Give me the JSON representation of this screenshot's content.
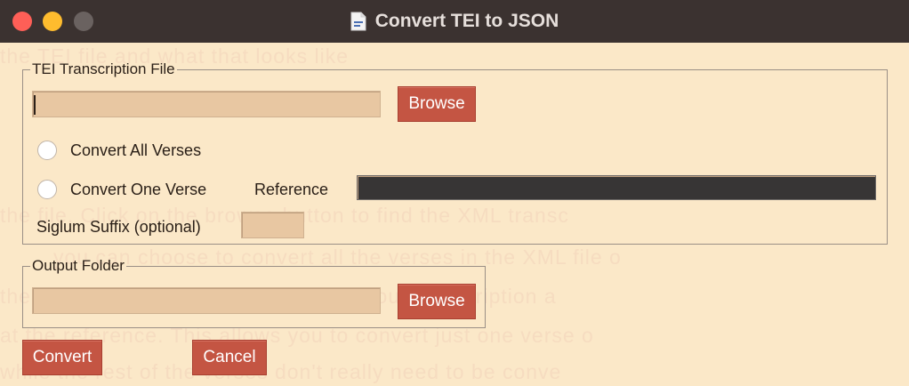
{
  "window": {
    "title": "Convert TEI to JSON",
    "title_icon": "document-icon"
  },
  "background_text": [
    "the TEI file and what that looks like",
    "the file. Click on the browse button to find the XML transc",
    "you can choose to convert all the verses in the XML file o",
    "the reference which will need to edit your transcription a",
    "at the reference. This allows you to convert just one verse o",
    "while the rest of the verses don't really need to be conve"
  ],
  "tei_group": {
    "legend": "TEI Transcription File",
    "file_value": "",
    "browse_label": "Browse",
    "convert_all_label": "Convert All Verses",
    "convert_one_label": "Convert One Verse",
    "reference_label": "Reference",
    "reference_value": "",
    "siglum_label": "Siglum Suffix (optional)",
    "siglum_value": ""
  },
  "output_group": {
    "legend": "Output Folder",
    "folder_value": "",
    "browse_label": "Browse"
  },
  "actions": {
    "convert_label": "Convert",
    "cancel_label": "Cancel"
  },
  "colors": {
    "window_bg": "#fbe8c8",
    "titlebar_bg": "#3b3230",
    "button_bg": "#c45543",
    "input_bg": "#e8c7a2",
    "reference_input_bg": "#373535"
  }
}
